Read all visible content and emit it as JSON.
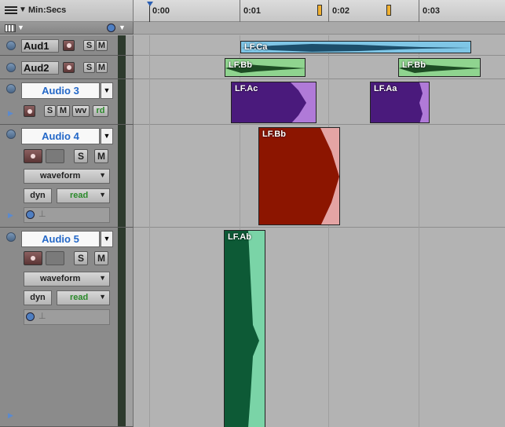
{
  "ruler": {
    "timebase_label": "Min:Secs",
    "ticks": [
      "0:00",
      "0:01",
      "0:02",
      "0:03"
    ]
  },
  "tracks": [
    {
      "name": "Aud1",
      "solo": "S",
      "mute": "M"
    },
    {
      "name": "Aud2",
      "solo": "S",
      "mute": "M"
    },
    {
      "name": "Audio 3",
      "solo": "S",
      "mute": "M",
      "waveform_btn": "wv",
      "read_btn": "rd"
    },
    {
      "name": "Audio 4",
      "solo": "S",
      "mute": "M",
      "view": "waveform",
      "dyn": "dyn",
      "automation": "read"
    },
    {
      "name": "Audio 5",
      "solo": "S",
      "mute": "M",
      "view": "waveform",
      "dyn": "dyn",
      "automation": "read"
    }
  ],
  "clips": [
    {
      "name": "LF.Ca",
      "color": "#7fc6e6"
    },
    {
      "name": "LF.Bb",
      "color": "#8fd48f"
    },
    {
      "name": "LF.Bb",
      "color": "#8fd48f"
    },
    {
      "name": "LF.Ac",
      "color": "#8e4cc2"
    },
    {
      "name": "LF.Aa",
      "color": "#8e4cc2"
    },
    {
      "name": "LF.Bb",
      "color": "#e4a4a4"
    },
    {
      "name": "LF.Ab",
      "color": "#1e8a58"
    }
  ],
  "colors": {
    "name_text": "#2468c8",
    "read_text": "#2a8a2a"
  }
}
